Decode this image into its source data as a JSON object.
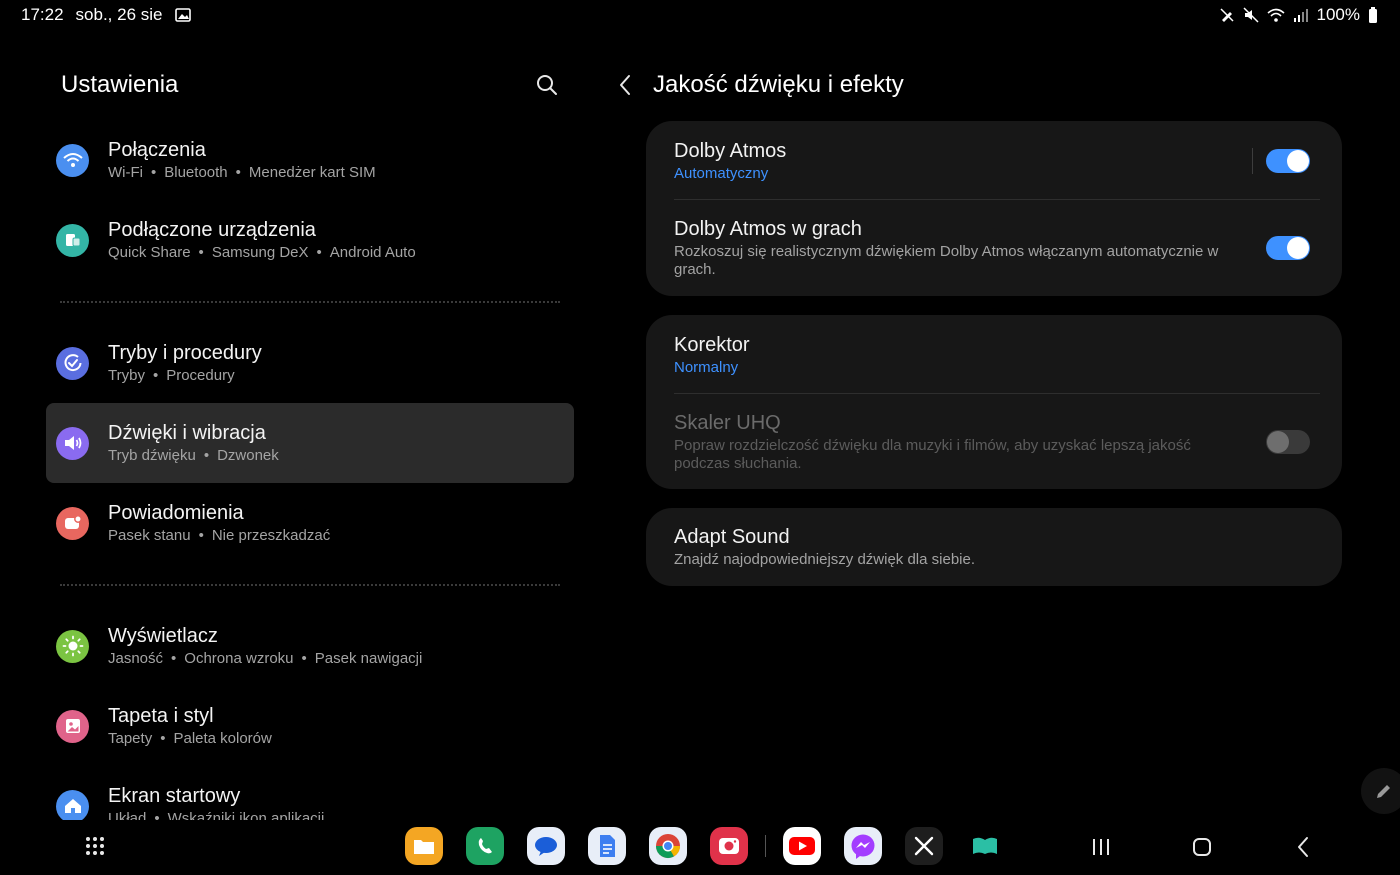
{
  "status_bar": {
    "time": "17:22",
    "date": "sob., 26 sie",
    "battery": "100%",
    "icons": [
      "gallery-icon",
      "pen-off-icon",
      "mute-icon",
      "wifi-icon",
      "signal-icon",
      "battery-icon"
    ]
  },
  "settings": {
    "title": "Ustawienia",
    "search_icon": "search-icon",
    "items": [
      {
        "label": "Połączenia",
        "sub": [
          "Wi-Fi",
          "Bluetooth",
          "Menedżer kart SIM"
        ],
        "color": "#4a8ff0",
        "icon": "wifi-icon"
      },
      {
        "label": "Podłączone urządzenia",
        "sub": [
          "Quick Share",
          "Samsung DeX",
          "Android Auto"
        ],
        "color": "#33b5a6",
        "icon": "devices-icon"
      },
      {
        "label": "Tryby i procedury",
        "sub": [
          "Tryby",
          "Procedury"
        ],
        "color": "#5a6ee0",
        "icon": "routine-check-icon"
      },
      {
        "label": "Dźwięki i wibracja",
        "sub": [
          "Tryb dźwięku",
          "Dzwonek"
        ],
        "color": "#8a6bf0",
        "icon": "speaker-icon"
      },
      {
        "label": "Powiadomienia",
        "sub": [
          "Pasek stanu",
          "Nie przeszkadzać"
        ],
        "color": "#e8675f",
        "icon": "notification-icon"
      },
      {
        "label": "Wyświetlacz",
        "sub": [
          "Jasność",
          "Ochrona wzroku",
          "Pasek nawigacji"
        ],
        "color": "#7bc442",
        "icon": "sun-icon"
      },
      {
        "label": "Tapeta i styl",
        "sub": [
          "Tapety",
          "Paleta kolorów"
        ],
        "color": "#e0638a",
        "icon": "wallpaper-icon"
      },
      {
        "label": "Ekran startowy",
        "sub": [
          "Układ",
          "Wskaźniki ikon aplikacji"
        ],
        "color": "#4a8ff0",
        "icon": "home-icon"
      }
    ]
  },
  "detail": {
    "title": "Jakość dźwięku i efekty",
    "dolby": {
      "label": "Dolby Atmos",
      "sub": "Automatyczny",
      "toggle": true
    },
    "dolby_games": {
      "label": "Dolby Atmos w grach",
      "sub": "Rozkoszuj się realistycznym dźwiękiem Dolby Atmos włączanym automatycznie w grach.",
      "toggle": true
    },
    "equalizer": {
      "label": "Korektor",
      "sub": "Normalny"
    },
    "uhq": {
      "label": "Skaler UHQ",
      "sub": "Popraw rozdzielczość dźwięku dla muzyki i filmów, aby uzyskać lepszą jakość podczas słuchania.",
      "toggle": false
    },
    "adapt": {
      "label": "Adapt Sound",
      "sub": "Znajdź najodpowiedniejszy dźwięk dla siebie."
    }
  },
  "taskbar": {
    "apps": [
      {
        "name": "files-app",
        "color": "#f4a623"
      },
      {
        "name": "phone-app",
        "color": "#1ea362"
      },
      {
        "name": "messages-app",
        "color": "#e8eef8"
      },
      {
        "name": "docs-app",
        "color": "#e8eef8"
      },
      {
        "name": "chrome-app",
        "color": "#e8eef8"
      },
      {
        "name": "screen-recorder-app",
        "color": "#e0324a"
      },
      {
        "name": "youtube-app",
        "color": "#ffffff"
      },
      {
        "name": "messenger-app",
        "color": "#e8eef8"
      },
      {
        "name": "x-app",
        "color": "#1e1e1e"
      },
      {
        "name": "book-app",
        "color": "#000000"
      }
    ]
  }
}
